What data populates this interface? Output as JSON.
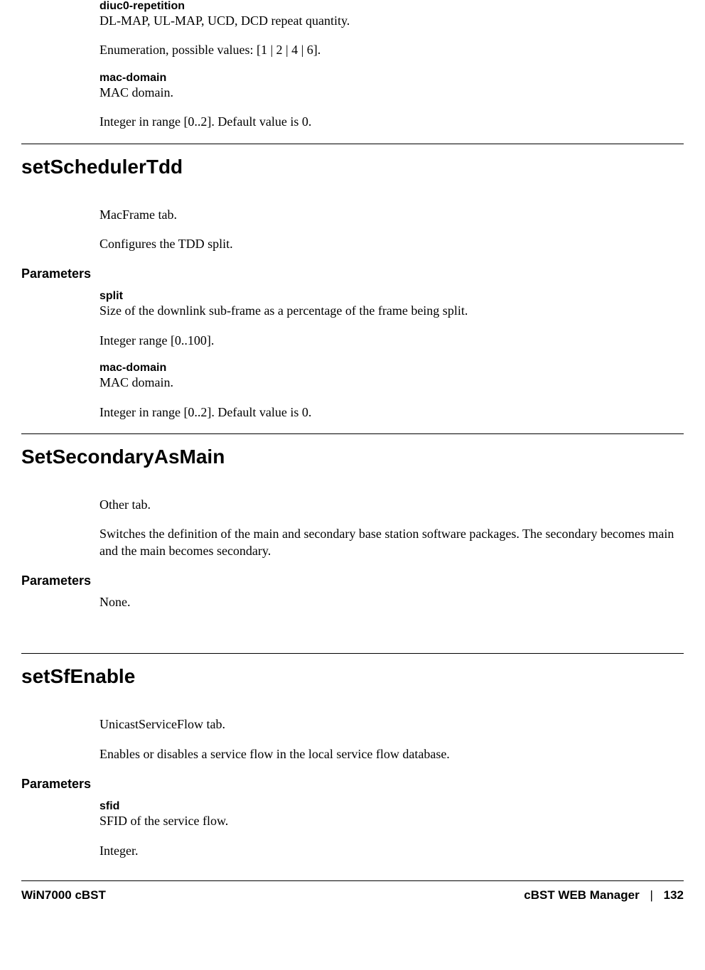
{
  "intro_params": {
    "diuc0_name": "diuc0-repetition",
    "diuc0_desc": "DL-MAP, UL-MAP, UCD, DCD repeat quantity.",
    "diuc0_enum": "Enumeration, possible values: [1 | 2 | 4 | 6].",
    "mac_name": "mac-domain",
    "mac_desc": "MAC domain.",
    "mac_range": "Integer in range [0..2]. Default value is 0."
  },
  "setSchedulerTdd": {
    "heading": "setSchedulerTdd",
    "tab": "MacFrame tab.",
    "desc": "Configures the TDD split.",
    "params_label": "Parameters",
    "split_name": "split",
    "split_desc": "Size of the downlink sub-frame as a percentage of the frame being split.",
    "split_range": "Integer range [0..100].",
    "mac_name": "mac-domain",
    "mac_desc": "MAC domain.",
    "mac_range": "Integer in range [0..2]. Default value is 0."
  },
  "SetSecondaryAsMain": {
    "heading": "SetSecondaryAsMain",
    "tab": "Other tab.",
    "desc": "Switches the definition of the main and secondary base station software packages. The secondary becomes main and the main becomes secondary.",
    "params_label": "Parameters",
    "none": "None."
  },
  "setSfEnable": {
    "heading": "setSfEnable",
    "tab": "UnicastServiceFlow tab.",
    "desc": "Enables or disables a service flow in the local service flow database.",
    "params_label": "Parameters",
    "sfid_name": "sfid",
    "sfid_desc": "SFID of the service flow.",
    "sfid_type": "Integer."
  },
  "footer": {
    "left": "WiN7000 cBST",
    "right_title": "cBST WEB Manager",
    "sep": "|",
    "page": "132"
  }
}
